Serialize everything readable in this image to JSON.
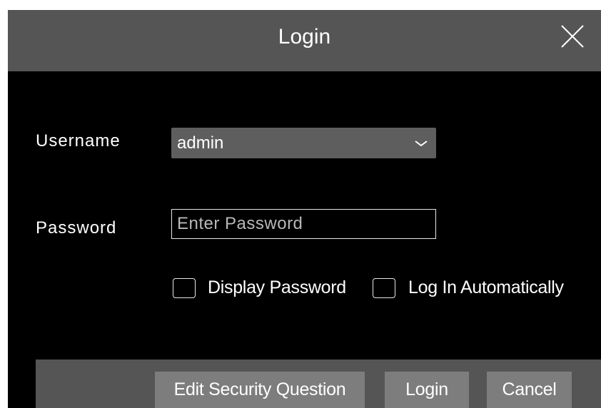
{
  "dialog": {
    "title": "Login",
    "close_icon": "close-icon"
  },
  "form": {
    "username_label": "Username",
    "username_value": "admin",
    "password_label": "Password",
    "password_placeholder": "Enter Password",
    "display_password_label": "Display Password",
    "display_password_checked": false,
    "auto_login_label": "Log In Automatically",
    "auto_login_checked": false
  },
  "footer": {
    "edit_security_label": "Edit Security Question",
    "login_label": "Login",
    "cancel_label": "Cancel"
  },
  "colors": {
    "titlebar": "#555555",
    "body": "#000000",
    "select_bg": "#5e5e5e",
    "button_bg": "#7d7d7d",
    "text": "#ffffff"
  }
}
